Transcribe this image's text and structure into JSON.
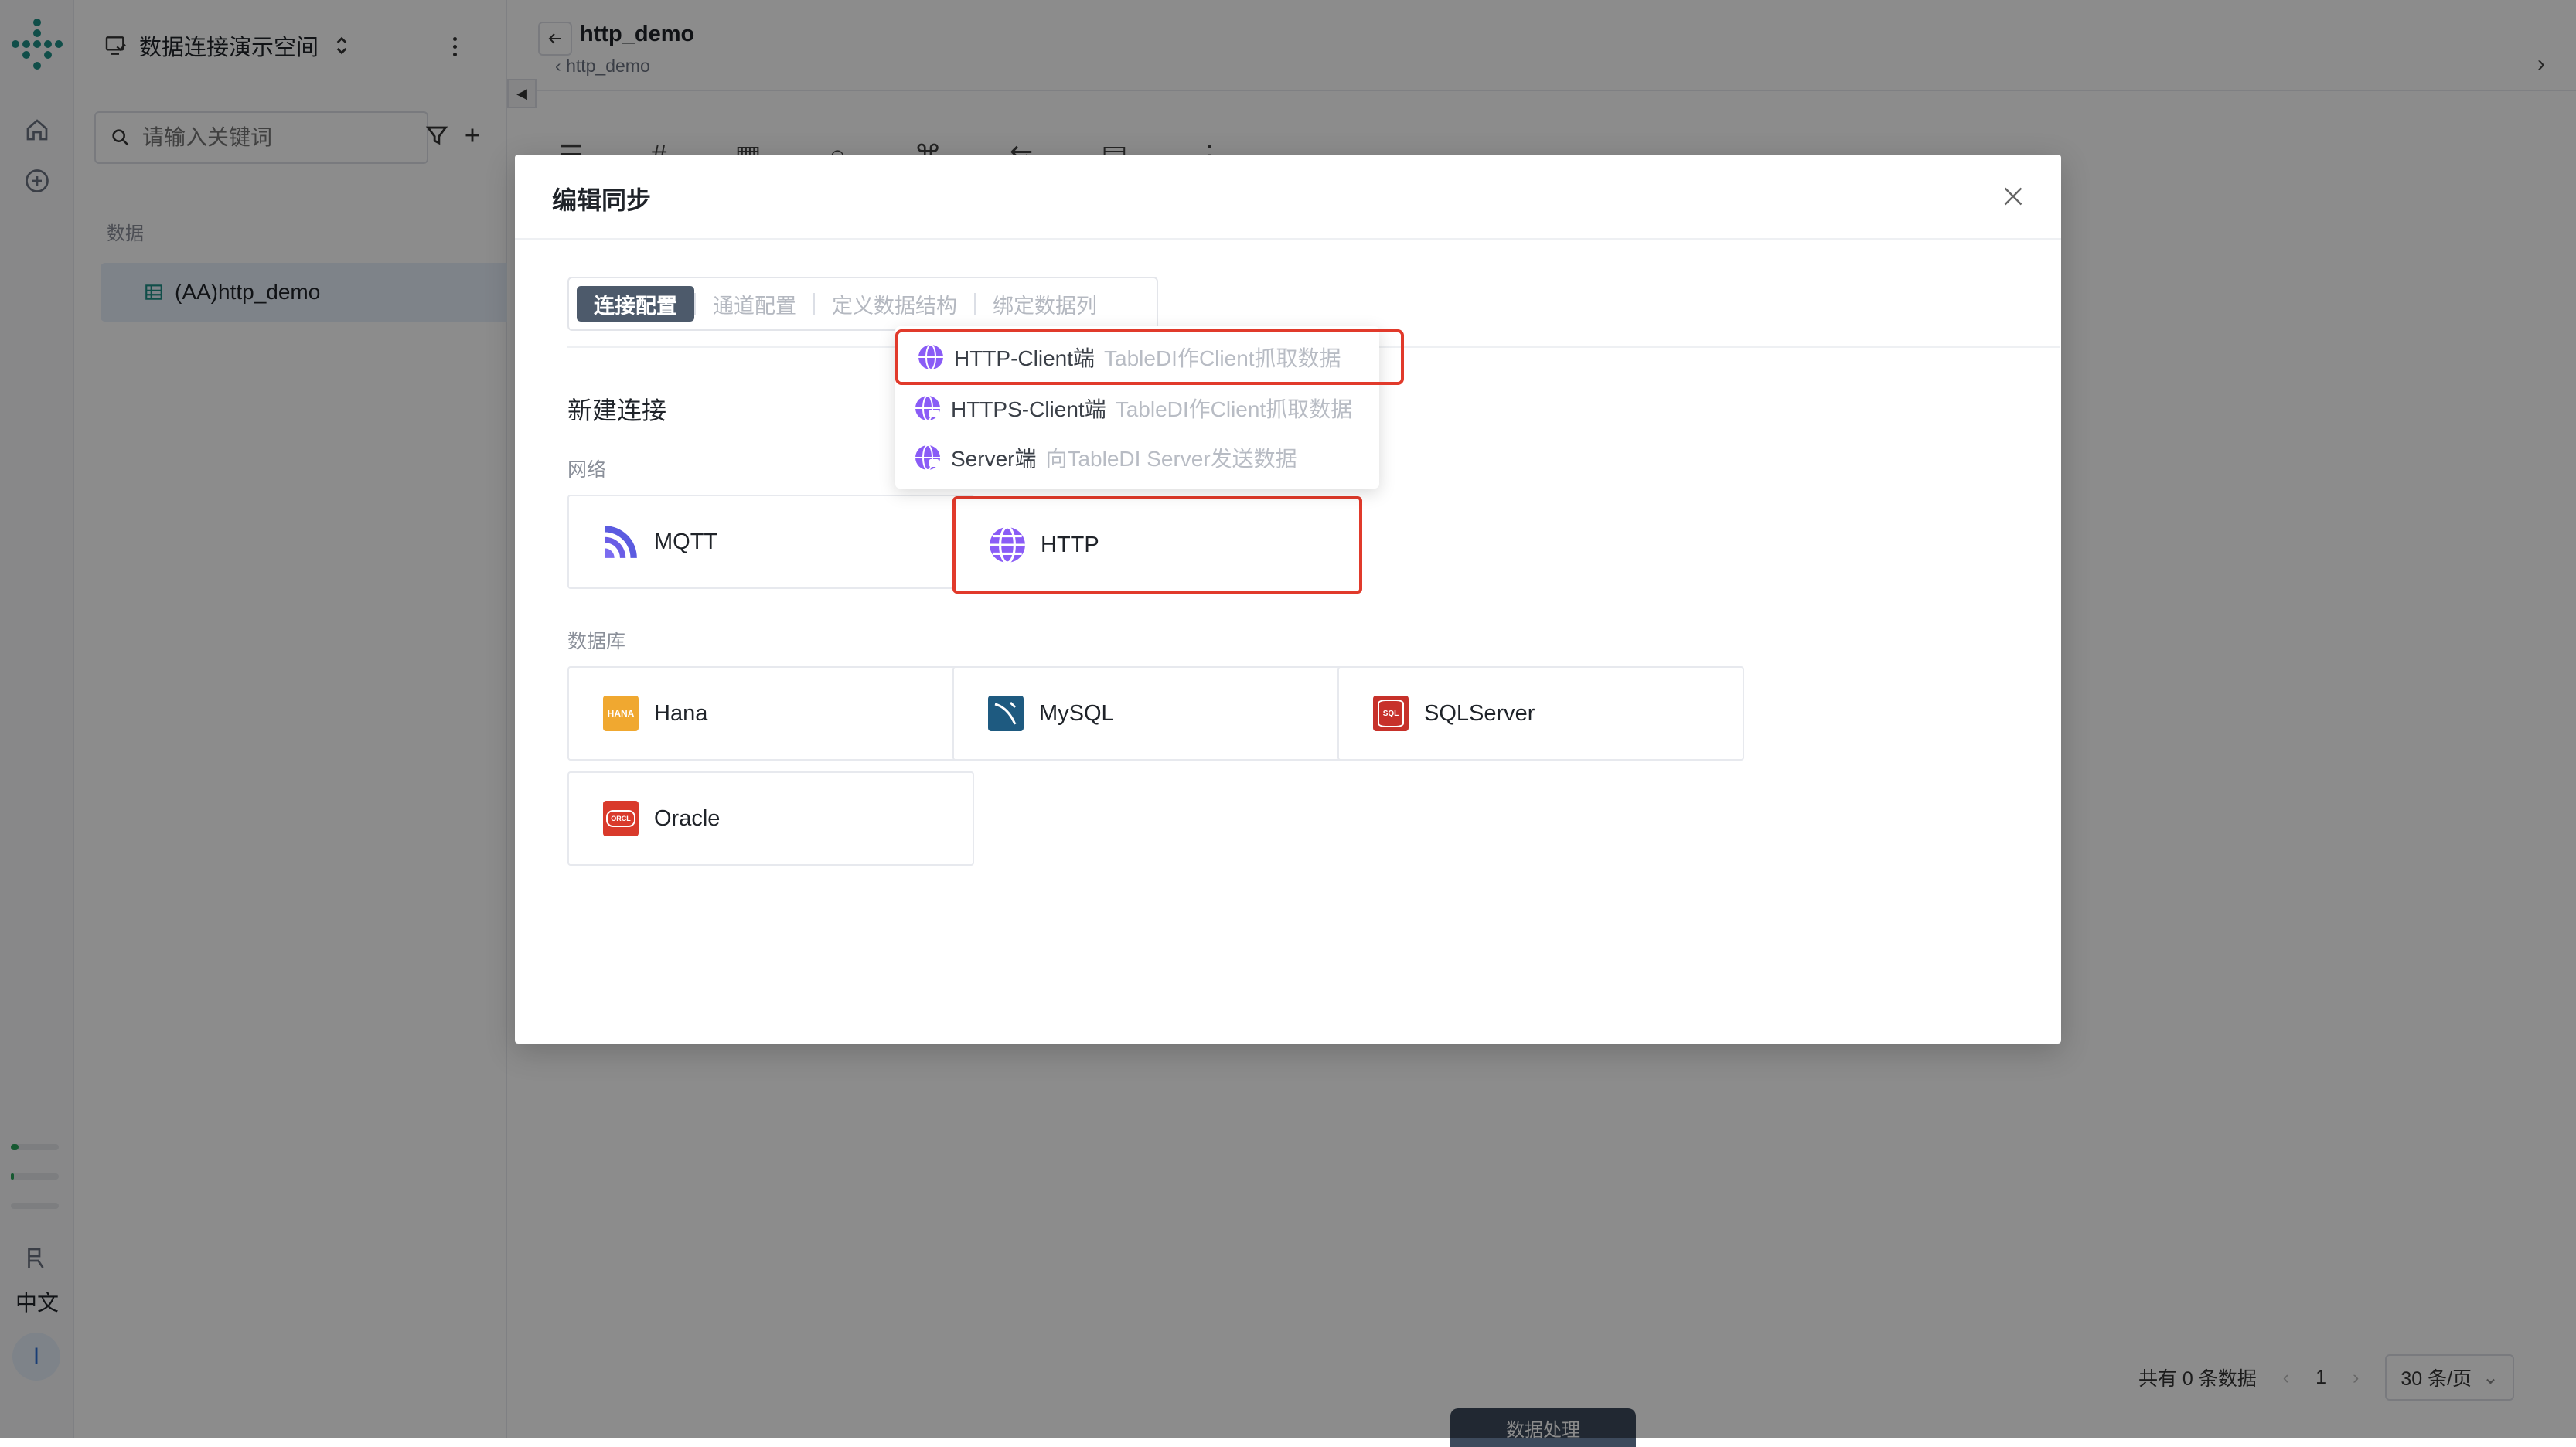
{
  "workspace": {
    "name": "数据连接演示空间"
  },
  "sidebar": {
    "search_placeholder": "请输入关键词",
    "section_label": "数据",
    "items": [
      {
        "label": "(AA)http_demo"
      }
    ]
  },
  "rail": {
    "language": "中文",
    "avatar_initial": "I"
  },
  "header": {
    "title": "http_demo",
    "breadcrumb": "http_demo"
  },
  "footer": {
    "total_text": "共有 0 条数据",
    "page": "1",
    "page_size": "30 条/页",
    "bottom_tab": "数据处理"
  },
  "modal": {
    "title": "编辑同步",
    "steps": [
      {
        "label": "连接配置"
      },
      {
        "label": "通道配置"
      },
      {
        "label": "定义数据结构"
      },
      {
        "label": "绑定数据列"
      }
    ],
    "new_connection": "新建连接",
    "network_label": "网络",
    "database_label": "数据库",
    "network_items": [
      {
        "label": "MQTT"
      },
      {
        "label": "HTTP"
      }
    ],
    "database_items": [
      {
        "label": "Hana"
      },
      {
        "label": "MySQL"
      },
      {
        "label": "SQLServer"
      },
      {
        "label": "Oracle"
      }
    ],
    "hana_badge": "HANA",
    "sql_badge": "SQL",
    "oracle_badge": "ORCL"
  },
  "dropdown": {
    "items": [
      {
        "label": "HTTP-Client端",
        "desc": "TableDI作Client抓取数据",
        "icon_text": "C"
      },
      {
        "label": "HTTPS-Client端",
        "desc": "TableDI作Client抓取数据",
        "icon_text": "C"
      },
      {
        "label": "Server端",
        "desc": "向TableDI Server发送数据",
        "icon_text": "S"
      }
    ]
  },
  "colors": {
    "accent_purple": "#8a5cf6",
    "highlight_red": "#e13a2b",
    "step_active": "#4d5a6b",
    "brand_teal": "#1e8e86"
  }
}
